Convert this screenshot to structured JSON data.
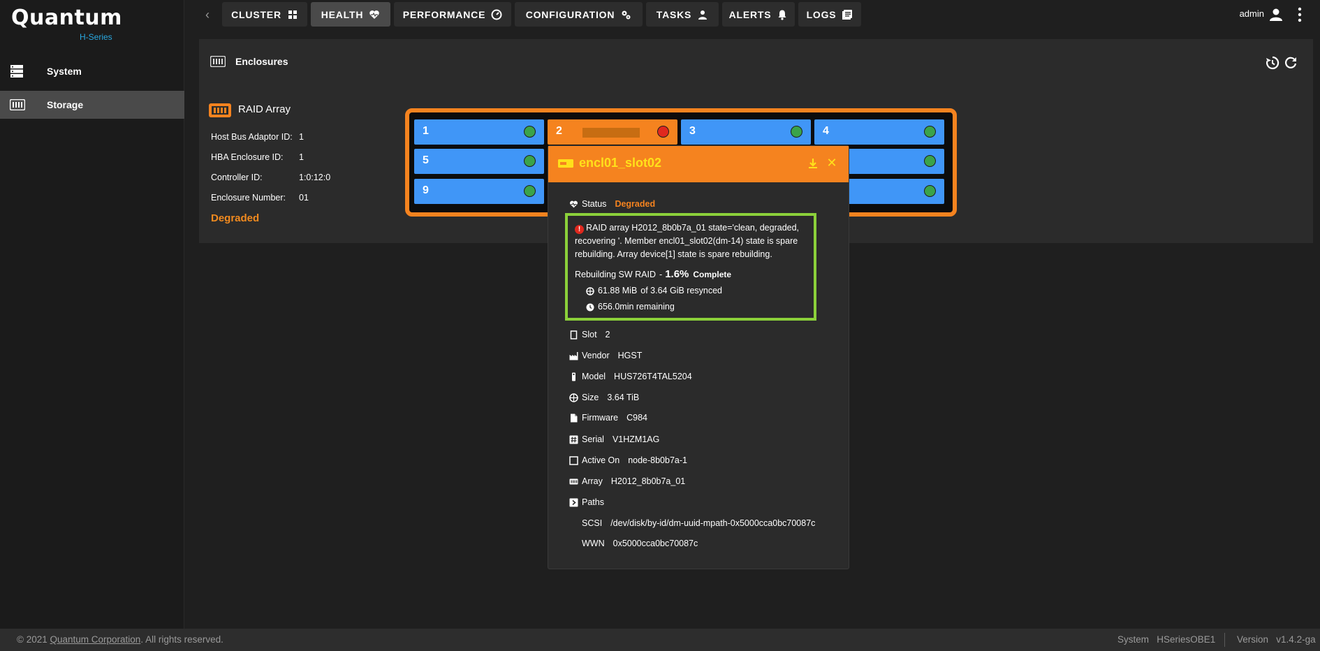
{
  "brand": {
    "name": "Quantum",
    "series": "H-Series"
  },
  "sidebar": {
    "items": [
      {
        "label": "System",
        "icon": "server-icon",
        "active": false
      },
      {
        "label": "Storage",
        "icon": "storage-icon",
        "active": true
      }
    ]
  },
  "nav": {
    "tabs": [
      {
        "label": "CLUSTER",
        "icon": "cluster-icon"
      },
      {
        "label": "HEALTH",
        "icon": "heart-pulse-icon"
      },
      {
        "label": "PERFORMANCE",
        "icon": "speedometer-icon"
      },
      {
        "label": "CONFIGURATION",
        "icon": "gears-icon"
      },
      {
        "label": "TASKS",
        "icon": "person-icon"
      },
      {
        "label": "ALERTS",
        "icon": "bell-icon"
      },
      {
        "label": "LOGS",
        "icon": "logs-icon"
      }
    ],
    "active_tab": "HEALTH",
    "user": "admin"
  },
  "panel": {
    "title": "Enclosures",
    "raid": {
      "title": "RAID Array",
      "fields": [
        {
          "label": "Host Bus Adaptor ID:",
          "value": "1"
        },
        {
          "label": "HBA Enclosure ID:",
          "value": "1"
        },
        {
          "label": "Controller ID:",
          "value": "1:0:12:0"
        },
        {
          "label": "Enclosure Number:",
          "value": "01"
        }
      ],
      "status": "Degraded"
    },
    "slots": [
      {
        "num": "1",
        "state": "ok"
      },
      {
        "num": "2",
        "state": "warn",
        "led": "red"
      },
      {
        "num": "3",
        "state": "ok"
      },
      {
        "num": "4",
        "state": "ok"
      },
      {
        "num": "5",
        "state": "ok"
      },
      {
        "num": "9",
        "state": "ok"
      }
    ]
  },
  "popup": {
    "title": "encl01_slot02",
    "status_label": "Status",
    "status_value": "Degraded",
    "alert": {
      "message": "RAID array H2012_8b0b7a_01 state='clean, degraded, recovering '. Member encl01_slot02(dm-14) state is spare rebuilding. Array device[1] state is spare rebuilding.",
      "rebuild_label": "Rebuilding SW RAID",
      "rebuild_dash": "-",
      "rebuild_pct": "1.6%",
      "rebuild_complete": "Complete",
      "resynced_amount": "61.88 MiB",
      "resynced_total": "of 3.64 GiB resynced",
      "remaining": "656.0min remaining"
    },
    "fields": [
      {
        "label": "Slot",
        "value": "2",
        "icon": "slot-icon"
      },
      {
        "label": "Vendor",
        "value": "HGST",
        "icon": "factory-icon"
      },
      {
        "label": "Model",
        "value": "HUS726T4TAL5204",
        "icon": "drive-icon"
      },
      {
        "label": "Size",
        "value": "3.64 TiB",
        "icon": "disk-icon"
      },
      {
        "label": "Firmware",
        "value": "C984",
        "icon": "file-icon"
      },
      {
        "label": "Serial",
        "value": "V1HZM1AG",
        "icon": "hash-icon"
      },
      {
        "label": "Active On",
        "value": "node-8b0b7a-1",
        "icon": "square-icon"
      },
      {
        "label": "Array",
        "value": "H2012_8b0b7a_01",
        "icon": "array-icon"
      },
      {
        "label": "Paths",
        "value": "",
        "icon": "chevron-right-icon"
      }
    ],
    "paths": [
      {
        "label": "SCSI",
        "value": "/dev/disk/by-id/dm-uuid-mpath-0x5000cca0bc70087c"
      },
      {
        "label": "WWN",
        "value": "0x5000cca0bc70087c"
      }
    ]
  },
  "footer": {
    "copyright": "© 2021",
    "company_link": "Quantum Corporation",
    "rights": ". All rights reserved.",
    "system_label": "System",
    "system_value": "HSeriesOBE1",
    "version_label": "Version",
    "version_value": "v1.4.2-ga"
  },
  "colors": {
    "accent_orange": "#f5831f",
    "slot_blue": "#4096f7",
    "ok_green": "#3aa34a",
    "error_red": "#e0281e",
    "highlight_green": "#8bd03a",
    "brand_blue": "#29a8e0"
  }
}
